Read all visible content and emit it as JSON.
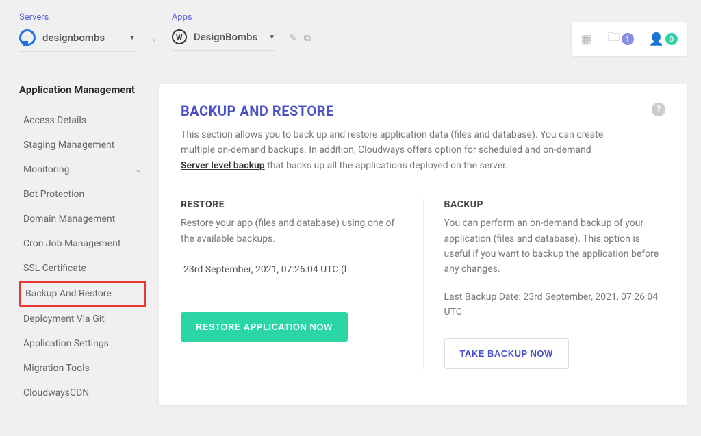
{
  "breadcrumb": {
    "servers_label": "Servers",
    "server_name": "designbombs",
    "apps_label": "Apps",
    "app_name": "DesignBombs"
  },
  "header_badges": {
    "folder_count": "1",
    "user_count": "0"
  },
  "sidebar": {
    "title": "Application Management",
    "items": [
      {
        "label": "Access Details",
        "chevron": false
      },
      {
        "label": "Staging Management",
        "chevron": false
      },
      {
        "label": "Monitoring",
        "chevron": true
      },
      {
        "label": "Bot Protection",
        "chevron": false
      },
      {
        "label": "Domain Management",
        "chevron": false
      },
      {
        "label": "Cron Job Management",
        "chevron": false
      },
      {
        "label": "SSL Certificate",
        "chevron": false
      },
      {
        "label": "Backup And Restore",
        "chevron": false,
        "highlighted": true
      },
      {
        "label": "Deployment Via Git",
        "chevron": false
      },
      {
        "label": "Application Settings",
        "chevron": false
      },
      {
        "label": "Migration Tools",
        "chevron": false
      },
      {
        "label": "CloudwaysCDN",
        "chevron": false
      }
    ]
  },
  "content": {
    "title": "BACKUP AND RESTORE",
    "desc_pre": "This section allows you to back up and restore application data (files and database). You can create multiple on-demand backups. In addition, Cloudways offers option for scheduled and on-demand ",
    "desc_link": "Server level backup",
    "desc_post": " that backs up all the applications deployed on the server.",
    "restore": {
      "title": "RESTORE",
      "desc": "Restore your app (files and database) using one of the available backups.",
      "selected": "23rd September, 2021, 07:26:04 UTC (l",
      "button": "RESTORE APPLICATION NOW"
    },
    "backup": {
      "title": "BACKUP",
      "desc": "You can perform an on-demand backup of your application (files and database). This option is useful if you want to backup the application before any changes.",
      "last_label": "Last Backup Date: 23rd September, 2021, 07:26:04 UTC",
      "button": "TAKE BACKUP NOW"
    }
  }
}
